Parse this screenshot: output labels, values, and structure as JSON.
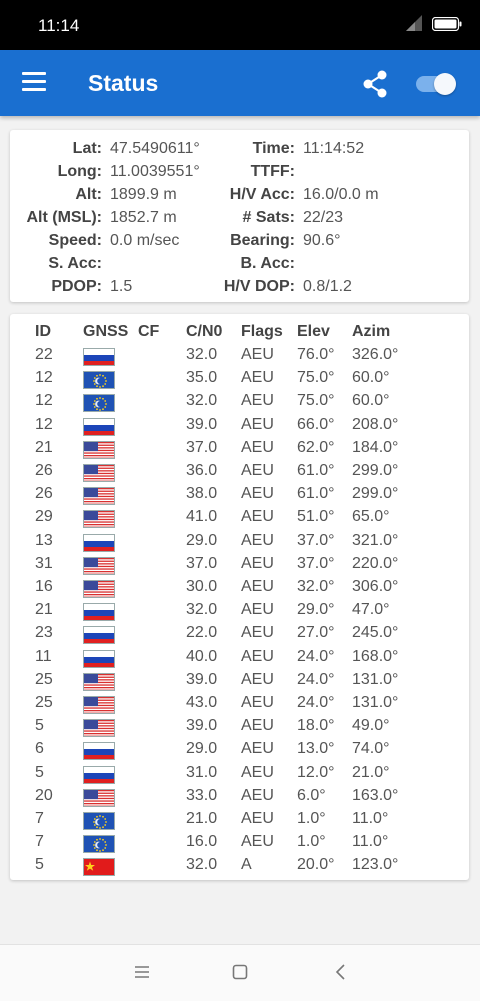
{
  "status_bar": {
    "time": "11:14"
  },
  "app_bar": {
    "title": "Status"
  },
  "summary": {
    "left": [
      {
        "label": "Lat:",
        "value": "47.5490611°"
      },
      {
        "label": "Long:",
        "value": "11.0039551°"
      },
      {
        "label": "Alt:",
        "value": "1899.9 m"
      },
      {
        "label": "Alt (MSL):",
        "value": "1852.7 m"
      },
      {
        "label": "Speed:",
        "value": "0.0 m/sec"
      },
      {
        "label": "S. Acc:",
        "value": ""
      },
      {
        "label": "PDOP:",
        "value": "1.5"
      }
    ],
    "right": [
      {
        "label": "Time:",
        "value": "11:14:52"
      },
      {
        "label": "TTFF:",
        "value": ""
      },
      {
        "label": "H/V Acc:",
        "value": "16.0/0.0 m"
      },
      {
        "label": "# Sats:",
        "value": "22/23"
      },
      {
        "label": "Bearing:",
        "value": "90.6°"
      },
      {
        "label": "B. Acc:",
        "value": ""
      },
      {
        "label": "H/V DOP:",
        "value": "0.8/1.2"
      }
    ]
  },
  "satellites": {
    "headers": {
      "id": "ID",
      "gnss": "GNSS",
      "cf": "CF",
      "cn0": "C/N0",
      "flags": "Flags",
      "elev": "Elev",
      "azim": "Azim"
    },
    "rows": [
      {
        "id": "22",
        "gnss": "russia",
        "cf": "",
        "cn0": "32.0",
        "flags": "AEU",
        "elev": "76.0°",
        "azim": "326.0°"
      },
      {
        "id": "12",
        "gnss": "eu",
        "cf": "",
        "cn0": "35.0",
        "flags": "AEU",
        "elev": "75.0°",
        "azim": "60.0°"
      },
      {
        "id": "12",
        "gnss": "eu",
        "cf": "",
        "cn0": "32.0",
        "flags": "AEU",
        "elev": "75.0°",
        "azim": "60.0°"
      },
      {
        "id": "12",
        "gnss": "russia",
        "cf": "",
        "cn0": "39.0",
        "flags": "AEU",
        "elev": "66.0°",
        "azim": "208.0°"
      },
      {
        "id": "21",
        "gnss": "usa",
        "cf": "",
        "cn0": "37.0",
        "flags": "AEU",
        "elev": "62.0°",
        "azim": "184.0°"
      },
      {
        "id": "26",
        "gnss": "usa",
        "cf": "",
        "cn0": "36.0",
        "flags": "AEU",
        "elev": "61.0°",
        "azim": "299.0°"
      },
      {
        "id": "26",
        "gnss": "usa",
        "cf": "",
        "cn0": "38.0",
        "flags": "AEU",
        "elev": "61.0°",
        "azim": "299.0°"
      },
      {
        "id": "29",
        "gnss": "usa",
        "cf": "",
        "cn0": "41.0",
        "flags": "AEU",
        "elev": "51.0°",
        "azim": "65.0°"
      },
      {
        "id": "13",
        "gnss": "russia",
        "cf": "",
        "cn0": "29.0",
        "flags": "AEU",
        "elev": "37.0°",
        "azim": "321.0°"
      },
      {
        "id": "31",
        "gnss": "usa",
        "cf": "",
        "cn0": "37.0",
        "flags": "AEU",
        "elev": "37.0°",
        "azim": "220.0°"
      },
      {
        "id": "16",
        "gnss": "usa",
        "cf": "",
        "cn0": "30.0",
        "flags": "AEU",
        "elev": "32.0°",
        "azim": "306.0°"
      },
      {
        "id": "21",
        "gnss": "russia",
        "cf": "",
        "cn0": "32.0",
        "flags": "AEU",
        "elev": "29.0°",
        "azim": "47.0°"
      },
      {
        "id": "23",
        "gnss": "russia",
        "cf": "",
        "cn0": "22.0",
        "flags": "AEU",
        "elev": "27.0°",
        "azim": "245.0°"
      },
      {
        "id": "11",
        "gnss": "russia",
        "cf": "",
        "cn0": "40.0",
        "flags": "AEU",
        "elev": "24.0°",
        "azim": "168.0°"
      },
      {
        "id": "25",
        "gnss": "usa",
        "cf": "",
        "cn0": "39.0",
        "flags": "AEU",
        "elev": "24.0°",
        "azim": "131.0°"
      },
      {
        "id": "25",
        "gnss": "usa",
        "cf": "",
        "cn0": "43.0",
        "flags": "AEU",
        "elev": "24.0°",
        "azim": "131.0°"
      },
      {
        "id": "5",
        "gnss": "usa",
        "cf": "",
        "cn0": "39.0",
        "flags": "AEU",
        "elev": "18.0°",
        "azim": "49.0°"
      },
      {
        "id": "6",
        "gnss": "russia",
        "cf": "",
        "cn0": "29.0",
        "flags": "AEU",
        "elev": "13.0°",
        "azim": "74.0°"
      },
      {
        "id": "5",
        "gnss": "russia",
        "cf": "",
        "cn0": "31.0",
        "flags": "AEU",
        "elev": "12.0°",
        "azim": "21.0°"
      },
      {
        "id": "20",
        "gnss": "usa",
        "cf": "",
        "cn0": "33.0",
        "flags": "AEU",
        "elev": "6.0°",
        "azim": "163.0°"
      },
      {
        "id": "7",
        "gnss": "eu",
        "cf": "",
        "cn0": "21.0",
        "flags": "AEU",
        "elev": "1.0°",
        "azim": "11.0°"
      },
      {
        "id": "7",
        "gnss": "eu",
        "cf": "",
        "cn0": "16.0",
        "flags": "AEU",
        "elev": "1.0°",
        "azim": "11.0°"
      },
      {
        "id": "5",
        "gnss": "china",
        "cf": "",
        "cn0": "32.0",
        "flags": "A",
        "elev": "20.0°",
        "azim": "123.0°"
      }
    ]
  },
  "colors": {
    "app_bar": "#1a6fd0",
    "toggle_track": "#7bb1ec"
  },
  "icons": {
    "menu": "hamburger-icon",
    "share": "share-icon",
    "toggle": "switch-toggle",
    "nav_recents": "recents-icon",
    "nav_home": "home-icon",
    "nav_back": "back-icon"
  }
}
